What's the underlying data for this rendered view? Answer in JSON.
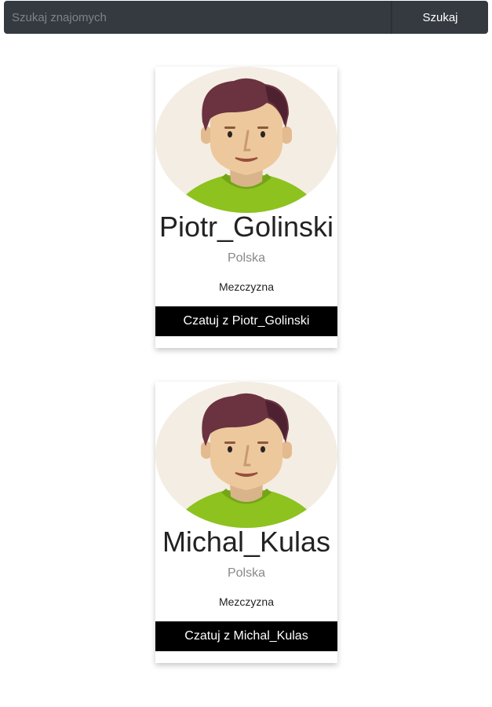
{
  "search": {
    "placeholder": "Szukaj znajomych",
    "value": "",
    "button_label": "Szukaj"
  },
  "colors": {
    "search_bar_bg": "#343a40",
    "chat_button_bg": "#000000",
    "avatar_bg": "#f4ede3",
    "shirt": "#8dc21f",
    "hair": "#6b3240",
    "skin": "#ecc89c"
  },
  "cards": [
    {
      "avatar_icon": "male-avatar-icon",
      "name": "Piotr_Golinski",
      "country": "Polska",
      "gender": "Mezczyzna",
      "chat_label": "Czatuj z Piotr_Golinski"
    },
    {
      "avatar_icon": "male-avatar-icon",
      "name": "Michal_Kulas",
      "country": "Polska",
      "gender": "Mezczyzna",
      "chat_label": "Czatuj z Michal_Kulas"
    }
  ]
}
